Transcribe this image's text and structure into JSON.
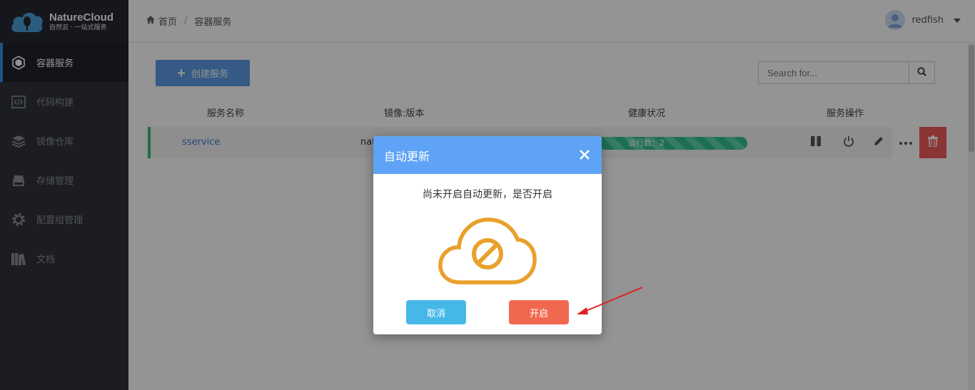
{
  "app": {
    "brand": "NatureCloud",
    "brand_sub": "自然云 · 一站式服务"
  },
  "sidebar": {
    "items": [
      {
        "label": "容器服务",
        "icon": "container-icon",
        "active": true
      },
      {
        "label": "代码构建",
        "icon": "code-icon"
      },
      {
        "label": "镜像仓库",
        "icon": "layers-icon"
      },
      {
        "label": "存储管理",
        "icon": "storage-icon"
      },
      {
        "label": "配置组管理",
        "icon": "gear-icon"
      },
      {
        "label": "文档",
        "icon": "books-icon"
      }
    ]
  },
  "header": {
    "breadcrumb": {
      "home": "首页",
      "separator": "/",
      "current": "容器服务"
    },
    "user": {
      "name": "redfish",
      "dropdown_icon": "caret-down-icon"
    }
  },
  "toolbar": {
    "create_label": "创建服务",
    "search_placeholder": "Search for..."
  },
  "table": {
    "headers": {
      "name": "服务名称",
      "image": "镜像:版本",
      "health": "健康状况",
      "ops": "服务操作"
    },
    "rows": [
      {
        "name": "sservice",
        "image": "nat",
        "health": "运行数：2"
      }
    ],
    "op_icons": [
      "pause-icon",
      "power-icon",
      "pencil-icon",
      "more-icon",
      "trash-icon"
    ]
  },
  "modal": {
    "title": "自动更新",
    "message": "尚未开启自动更新，是否开启",
    "cancel_label": "取消",
    "confirm_label": "开启"
  },
  "colors": {
    "sidebar_bg": "#2f323b",
    "primary": "#5a9be5",
    "modal_header": "#5ea3f5",
    "cloud_icon": "#e9a02c",
    "cancel": "#45b8e8",
    "confirm": "#f0694f",
    "health": "#32c08f",
    "delete": "#f05a5a",
    "annotation_arrow": "#e02020"
  }
}
